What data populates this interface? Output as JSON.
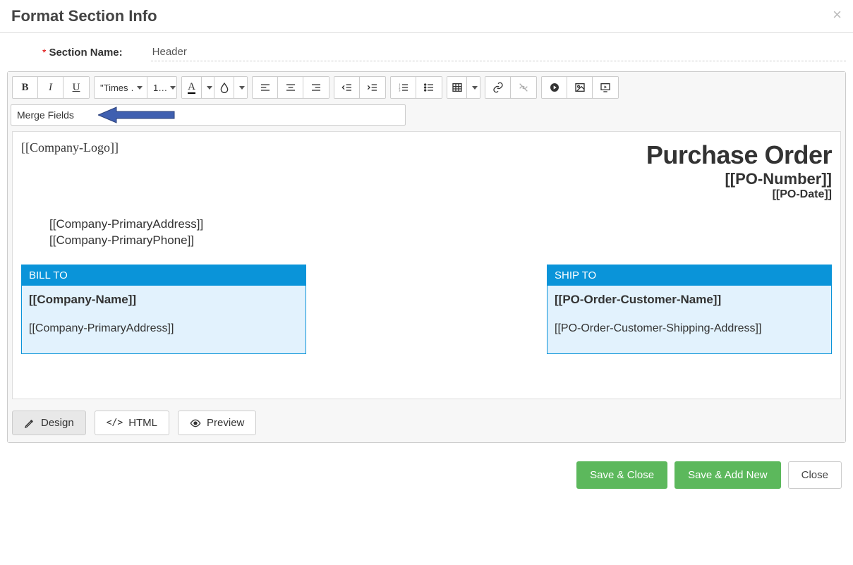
{
  "modal": {
    "title": "Format Section Info",
    "close_icon": "×"
  },
  "section_name": {
    "label": "Section Name:",
    "value": "Header"
  },
  "toolbar": {
    "font_family": "\"Times …",
    "font_size": "1…",
    "merge_fields_label": "Merge Fields"
  },
  "doc": {
    "logo_token": "[[Company-Logo]]",
    "po_title": "Purchase Order",
    "po_number": "[[PO-Number]]",
    "po_date": "[[PO-Date]]",
    "company_address": "[[Company-PrimaryAddress]]",
    "company_phone": "[[Company-PrimaryPhone]]",
    "bill_to_label": "BILL TO",
    "bill_to_name": "[[Company-Name]]",
    "bill_to_address": "[[Company-PrimaryAddress]]",
    "ship_to_label": "SHIP TO",
    "ship_to_name": "[[PO-Order-Customer-Name]]",
    "ship_to_address": "[[PO-Order-Customer-Shipping-Address]]"
  },
  "view_tabs": {
    "design": "Design",
    "html": "HTML",
    "preview": "Preview"
  },
  "footer": {
    "save_close": "Save & Close",
    "save_add_new": "Save & Add New",
    "close": "Close"
  },
  "colors": {
    "accent_blue": "#0a94d9",
    "panel_bg": "#e2f2fd",
    "btn_green": "#5cb85c",
    "callout_arrow": "#3f5fb0"
  }
}
